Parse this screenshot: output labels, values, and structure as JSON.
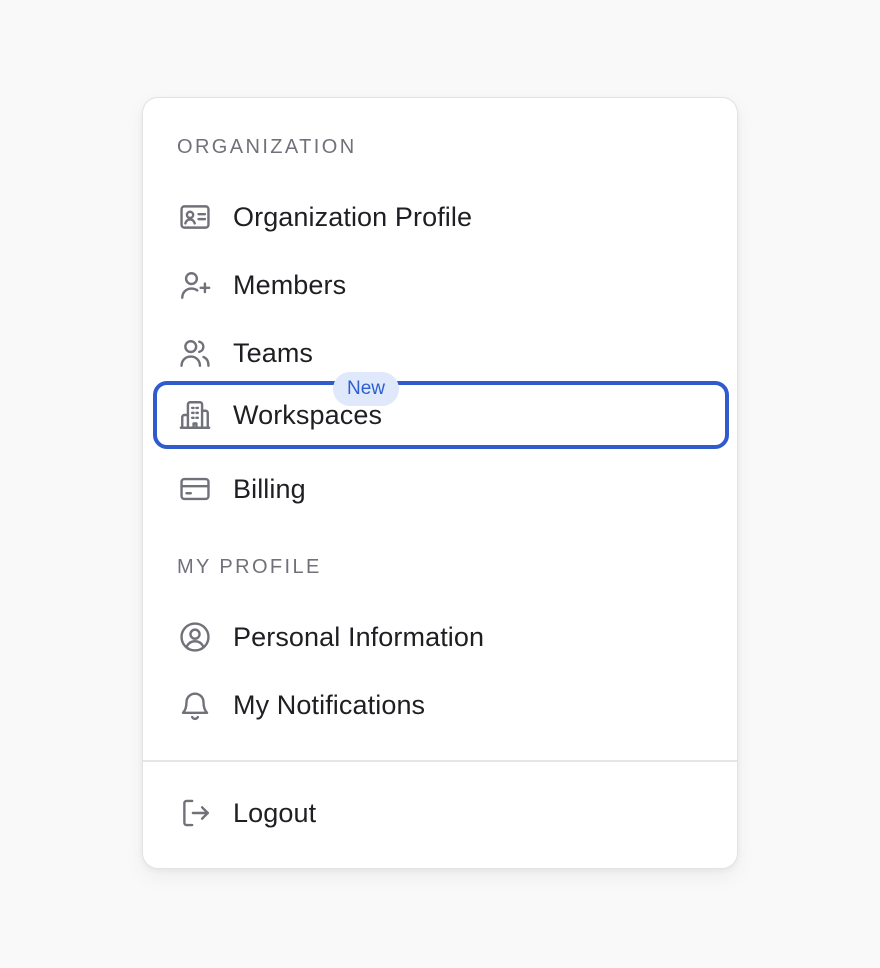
{
  "organization": {
    "section_label": "ORGANIZATION",
    "items": [
      {
        "label": "Organization Profile",
        "icon": "id-card-icon"
      },
      {
        "label": "Members",
        "icon": "user-plus-icon"
      },
      {
        "label": "Teams",
        "icon": "users-icon"
      },
      {
        "label": "Workspaces",
        "icon": "building-icon",
        "active": true
      },
      {
        "label": "Billing",
        "icon": "credit-card-icon",
        "badge": "New"
      }
    ]
  },
  "my_profile": {
    "section_label": "MY PROFILE",
    "items": [
      {
        "label": "Personal Information",
        "icon": "user-circle-icon"
      },
      {
        "label": "My Notifications",
        "icon": "bell-icon"
      }
    ]
  },
  "footer": {
    "logout_label": "Logout",
    "logout_icon": "logout-icon"
  },
  "colors": {
    "active_border": "#2f5bcd",
    "badge_bg": "#dfe9fb",
    "badge_text": "#2e5fcf",
    "icon": "#71717a",
    "text": "#1f1f23"
  }
}
